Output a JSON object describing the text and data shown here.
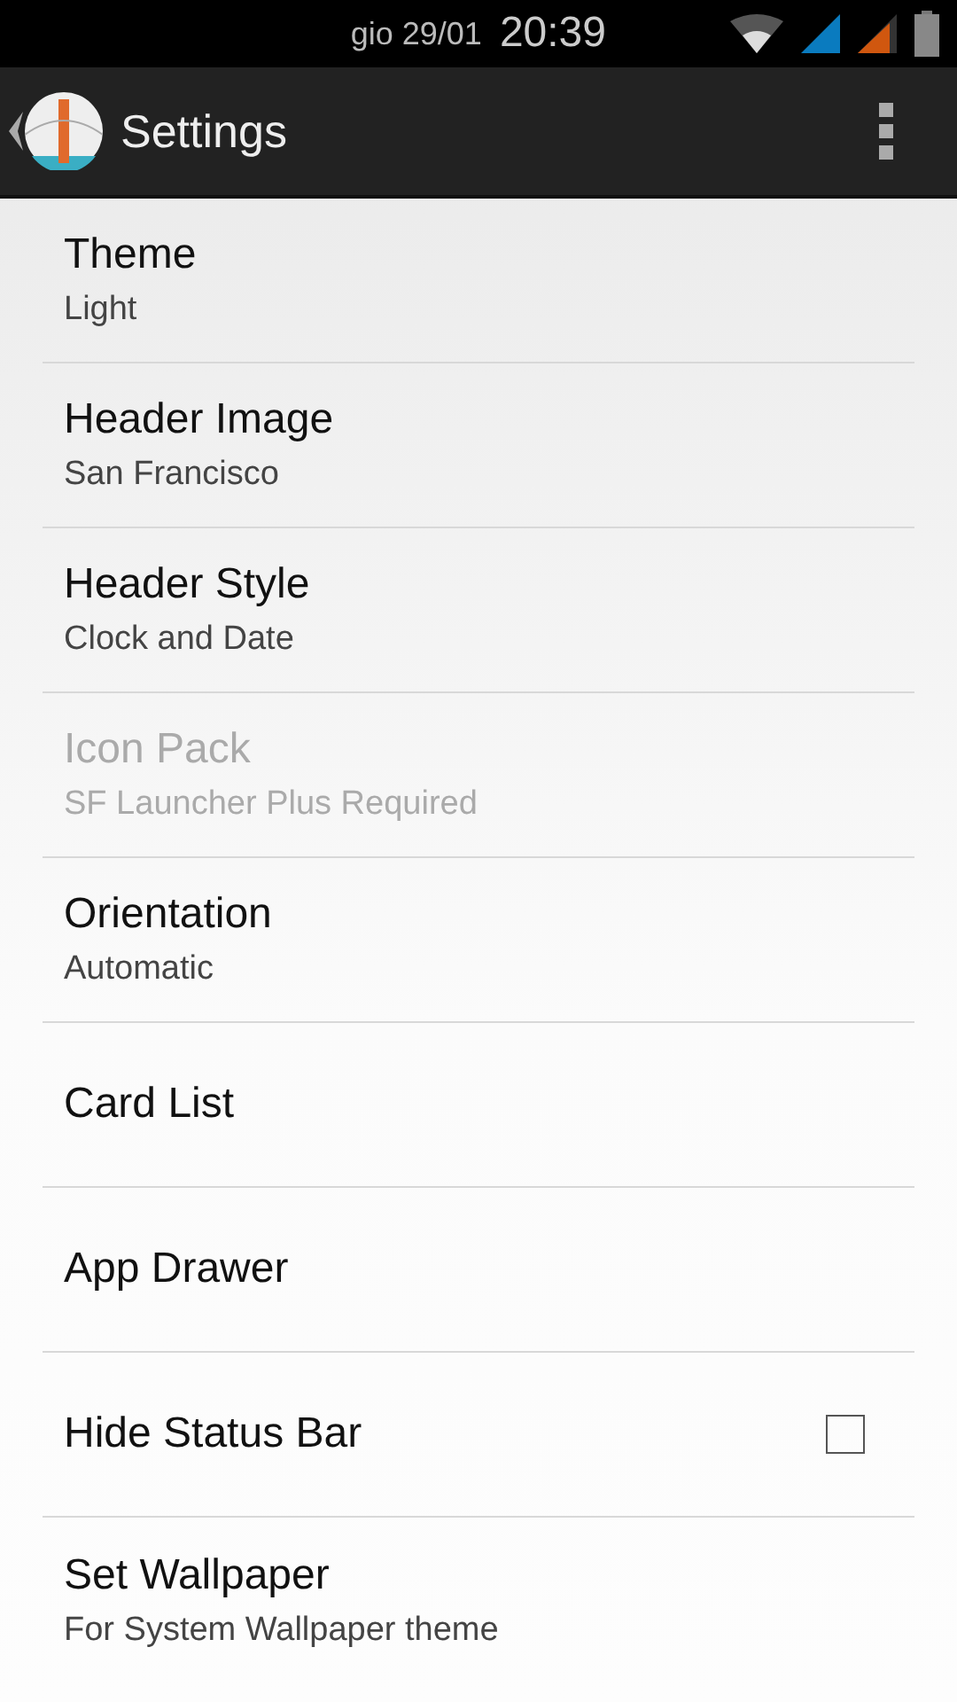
{
  "status_bar": {
    "date": "gio 29/01",
    "time": "20:39"
  },
  "action_bar": {
    "title": "Settings"
  },
  "items": [
    {
      "title": "Theme",
      "summary": "Light",
      "disabled": false,
      "kind": "plain"
    },
    {
      "title": "Header Image",
      "summary": "San Francisco",
      "disabled": false,
      "kind": "plain"
    },
    {
      "title": "Header Style",
      "summary": "Clock and Date",
      "disabled": false,
      "kind": "plain"
    },
    {
      "title": "Icon Pack",
      "summary": "SF Launcher Plus Required",
      "disabled": true,
      "kind": "plain"
    },
    {
      "title": "Orientation",
      "summary": "Automatic",
      "disabled": false,
      "kind": "plain"
    },
    {
      "title": "Card List",
      "disabled": false,
      "kind": "plain"
    },
    {
      "title": "App Drawer",
      "disabled": false,
      "kind": "plain"
    },
    {
      "title": "Hide Status Bar",
      "disabled": false,
      "kind": "checkbox",
      "checked": false
    },
    {
      "title": "Set Wallpaper",
      "summary": "For System Wallpaper theme",
      "disabled": false,
      "kind": "plain"
    }
  ]
}
